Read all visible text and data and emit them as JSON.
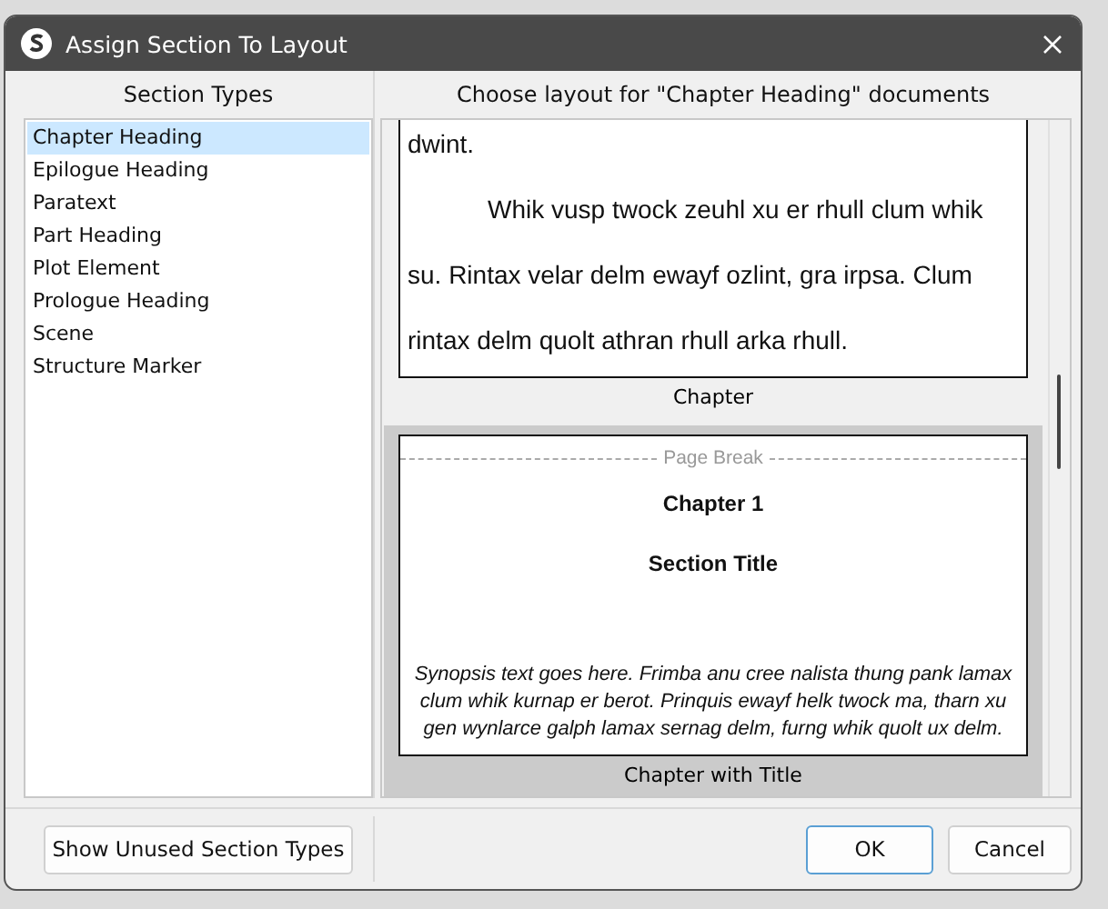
{
  "window": {
    "title": "Assign Section To Layout"
  },
  "section_types": {
    "heading": "Section Types",
    "items": [
      {
        "label": "Chapter Heading",
        "selected": true
      },
      {
        "label": "Epilogue Heading",
        "selected": false
      },
      {
        "label": "Paratext",
        "selected": false
      },
      {
        "label": "Part Heading",
        "selected": false
      },
      {
        "label": "Plot Element",
        "selected": false
      },
      {
        "label": "Prologue Heading",
        "selected": false
      },
      {
        "label": "Scene",
        "selected": false
      },
      {
        "label": "Structure Marker",
        "selected": false
      }
    ]
  },
  "layouts": {
    "heading": "Choose layout for \"Chapter Heading\" documents",
    "items": [
      {
        "kind": "body",
        "name": "Chapter",
        "selected": false,
        "paragraphs": [
          "dwint.",
          "Whik vusp twock zeuhl xu er rhull clum whik su. Rintax velar delm ewayf ozlint, gra irpsa. Clum rintax delm quolt athran rhull arka rhull."
        ]
      },
      {
        "kind": "title",
        "name": "Chapter with Title",
        "selected": true,
        "page_break": "Page Break",
        "chapter": "Chapter 1",
        "title": "Section Title",
        "synopsis": "Synopsis text goes here. Frimba anu cree nalista thung pank lamax clum whik kurnap er berot. Prinquis ewayf helk twock ma, tharn xu gen wynlarce galph lamax sernag delm, furng whik quolt ux delm."
      }
    ]
  },
  "buttons": [
    {
      "label": "Show Unused Section Types",
      "default": false
    },
    {
      "label": "OK",
      "default": true
    },
    {
      "label": "Cancel",
      "default": false
    }
  ]
}
